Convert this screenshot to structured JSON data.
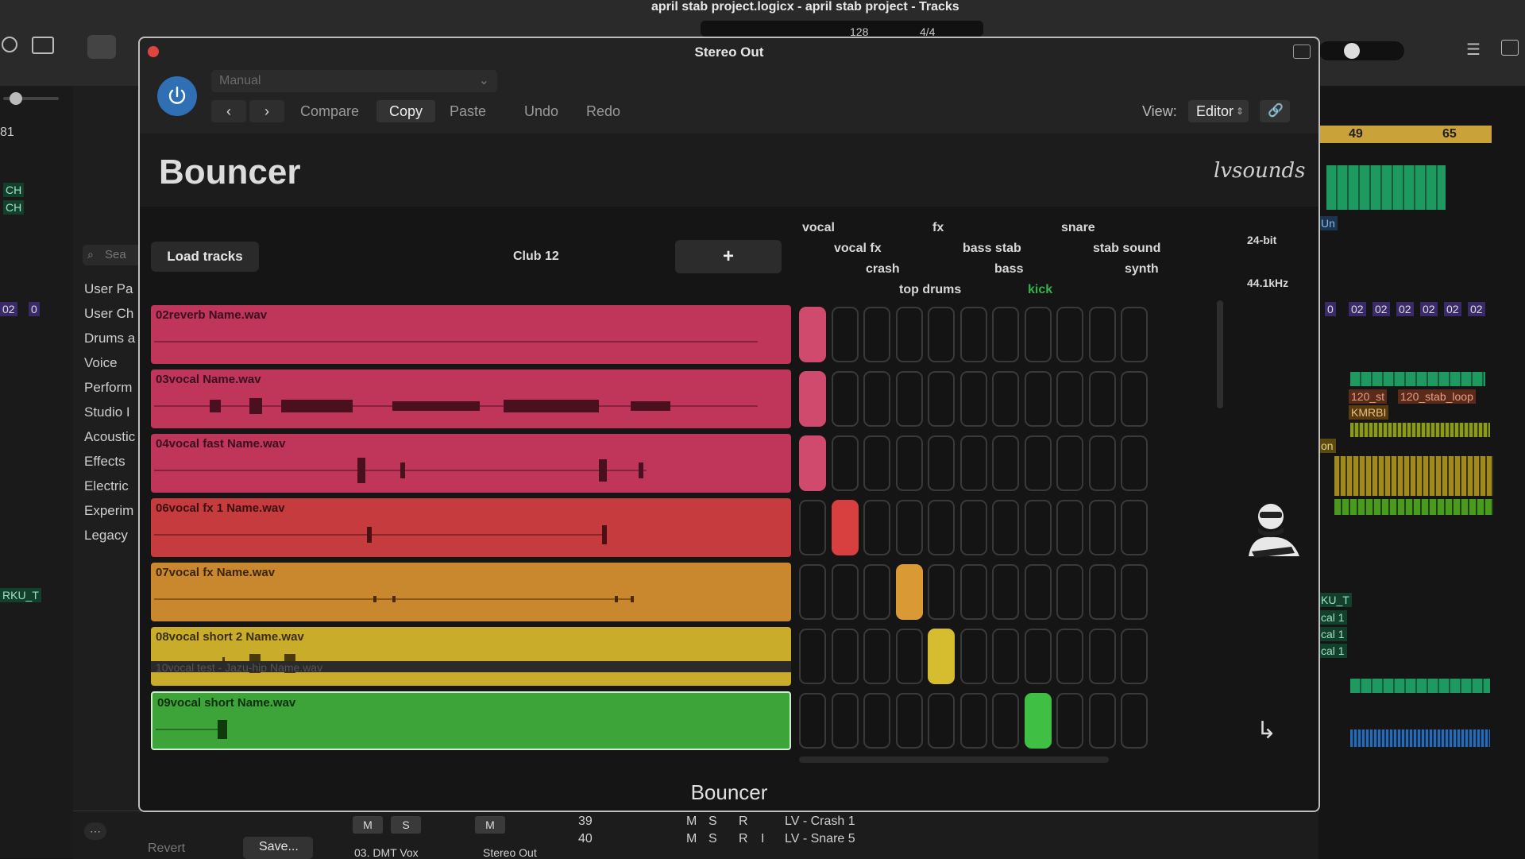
{
  "background": {
    "window_title": "april stab project.logicx - april stab project - Tracks",
    "transport": {
      "tempo": "128",
      "signature": "4/4"
    },
    "ruler_markers": [
      "81",
      "49",
      "65"
    ],
    "browser_items": [
      "User Pa",
      "User Ch",
      "Drums a",
      "Voice",
      "Perform",
      "Studio I",
      "Acoustic",
      "Effects",
      "Electric",
      "Experim",
      "Legacy"
    ],
    "search_placeholder": "Sea",
    "left_labels": [
      "CH",
      "CH",
      "02",
      "0",
      "RKU_T"
    ],
    "right_labels": [
      "Un",
      "0",
      "02",
      "02",
      "02",
      "02",
      "02",
      "02",
      "120_st",
      "120_stab_loop",
      "KMRBI",
      "on",
      "KU_T",
      "cal 1",
      "cal 1",
      "cal 1"
    ],
    "mixer_rows": [
      {
        "num": "39",
        "name": "LV - Crash 1"
      },
      {
        "num": "40",
        "name": "LV - Snare 5"
      }
    ],
    "mixer_buttons": [
      "M",
      "S",
      "R",
      "I"
    ],
    "bottom": {
      "revert": "Revert",
      "save": "Save...",
      "channel_a": "03. DMT Vox",
      "channel_b": "Stereo Out",
      "m_label": "M",
      "s_label": "S"
    }
  },
  "plugin": {
    "window_title": "Stereo Out",
    "preset": "Manual",
    "toolbar": {
      "compare": "Compare",
      "copy": "Copy",
      "paste": "Paste",
      "undo": "Undo",
      "redo": "Redo",
      "view_label": "View:",
      "view_value": "Editor"
    },
    "title": "Bouncer",
    "brand": "lvsounds",
    "load_button": "Load tracks",
    "preset_name": "Club 12",
    "add_button": "+",
    "bit_depth": "24-bit",
    "sample_rate": "44.1kHz",
    "categories": [
      {
        "label": "vocal",
        "active": false
      },
      {
        "label": "vocal fx",
        "active": false
      },
      {
        "label": "crash",
        "active": false
      },
      {
        "label": "top drums",
        "active": false
      },
      {
        "label": "fx",
        "active": false
      },
      {
        "label": "bass stab",
        "active": false
      },
      {
        "label": "bass",
        "active": false
      },
      {
        "label": "kick",
        "active": true
      },
      {
        "label": "snare",
        "active": false
      },
      {
        "label": "stab sound",
        "active": false
      },
      {
        "label": "synth",
        "active": false
      }
    ],
    "tracks": [
      {
        "name": "02reverb Name.wav",
        "color": "#c0355a",
        "text_color": "#3a1020",
        "selected_pad": 0,
        "pad_color": "#d04a6e",
        "selected": false
      },
      {
        "name": "03vocal Name.wav",
        "color": "#c0355a",
        "text_color": "#3a1020",
        "selected_pad": 0,
        "pad_color": "#d04a6e",
        "selected": false
      },
      {
        "name": "04vocal fast Name.wav",
        "color": "#c0355a",
        "text_color": "#3a1020",
        "selected_pad": 0,
        "pad_color": "#d04a6e",
        "selected": false
      },
      {
        "name": "06vocal fx 1 Name.wav",
        "color": "#c63b3e",
        "text_color": "#3a1012",
        "selected_pad": 1,
        "pad_color": "#d8403f",
        "selected": false
      },
      {
        "name": "07vocal fx Name.wav",
        "color": "#c9872e",
        "text_color": "#3b2408",
        "selected_pad": 3,
        "pad_color": "#d99a35",
        "selected": false
      },
      {
        "name": "08vocal short 2 Name.wav",
        "color": "#c9ad2a",
        "text_color": "#3a3008",
        "selected_pad": 4,
        "pad_color": "#d6bd2f",
        "selected": false
      },
      {
        "name": "09vocal short Name.wav",
        "color": "#3da43a",
        "text_color": "#0f2e0c",
        "selected_pad": 7,
        "pad_color": "#3fbf43",
        "selected": true
      }
    ],
    "next_track_partial": "10vocal test - Jazu-hip Name.wav",
    "footer": "Bouncer"
  }
}
